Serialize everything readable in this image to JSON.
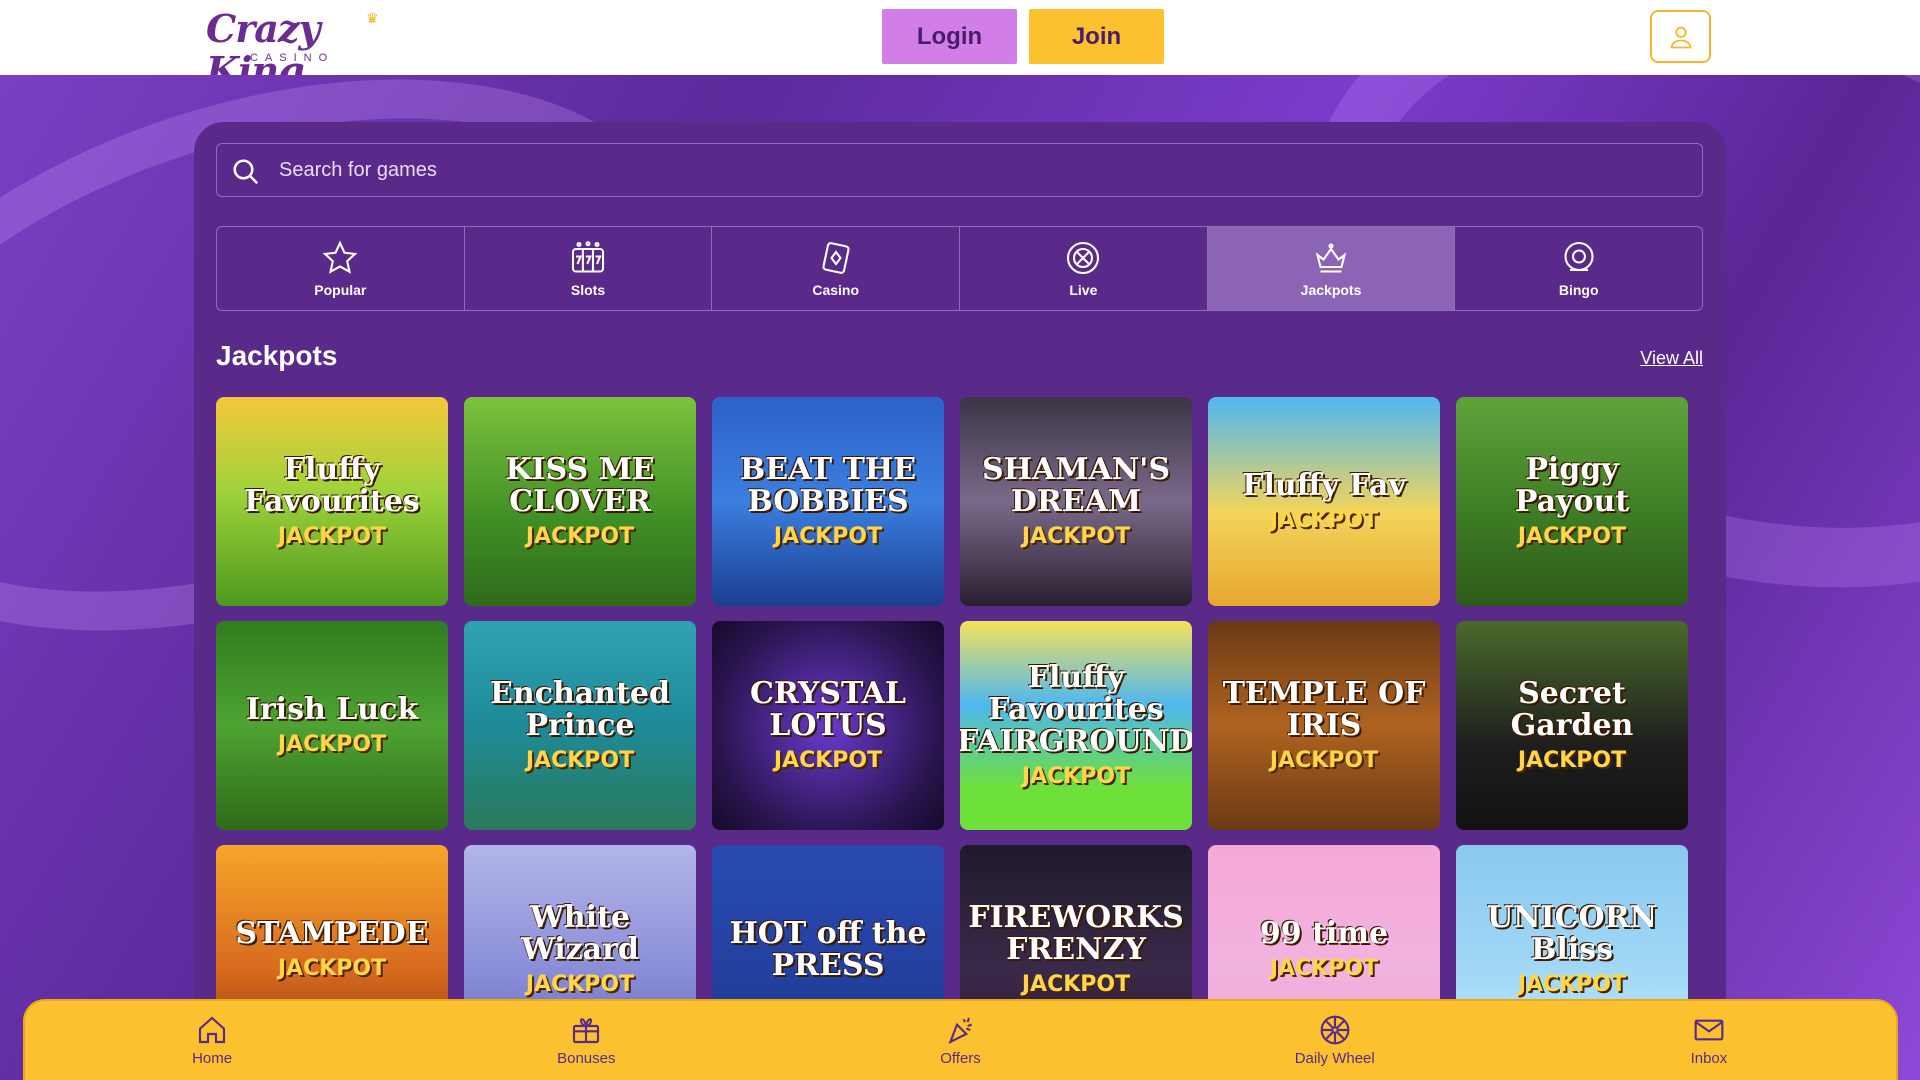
{
  "header": {
    "logo_text": "Crazy King",
    "logo_sub": "CASINO",
    "login_label": "Login",
    "join_label": "Join",
    "account_icon": "user-icon"
  },
  "search": {
    "placeholder": "Search for games",
    "icon": "search-icon"
  },
  "categories": [
    {
      "label": "Popular",
      "icon": "star-icon",
      "active": false
    },
    {
      "label": "Slots",
      "icon": "slot-machine-icon",
      "active": false
    },
    {
      "label": "Casino",
      "icon": "cards-icon",
      "active": false
    },
    {
      "label": "Live",
      "icon": "roulette-icon",
      "active": false
    },
    {
      "label": "Jackpots",
      "icon": "crown-icon",
      "active": true
    },
    {
      "label": "Bingo",
      "icon": "bingo-ball-icon",
      "active": false
    }
  ],
  "section": {
    "title": "Jackpots",
    "view_all": "View All"
  },
  "games": [
    {
      "name": "Fluffy Favourites",
      "sub": "JACKPOT",
      "bg": "linear-gradient(180deg,#f5c83a 0%,#9fd33a 45%,#4e9a1e 100%)"
    },
    {
      "name": "KISS ME CLOVER",
      "sub": "JACKPOT",
      "bg": "linear-gradient(180deg,#7cc23b 0%,#3f8e25 60%,#2e6a1a 100%)"
    },
    {
      "name": "BEAT THE BOBBIES",
      "sub": "JACKPOT",
      "bg": "linear-gradient(180deg,#2d62c9 0%,#3b7fe0 50%,#1c3f92 100%)"
    },
    {
      "name": "SHAMAN'S DREAM",
      "sub": "JACKPOT",
      "bg": "linear-gradient(180deg,#3b3545 0%,#7a6a8a 50%,#2a2030 100%)"
    },
    {
      "name": "Fluffy Fav",
      "sub": "JACKPOT",
      "bg": "linear-gradient(180deg,#4fb7f0 0%,#f2d55a 55%,#e9a630 100%)"
    },
    {
      "name": "Piggy Payout",
      "sub": "JACKPOT",
      "bg": "linear-gradient(180deg,#5fa33a 0%,#3b7a23 60%,#2e5a1a 100%)"
    },
    {
      "name": "Irish Luck",
      "sub": "JACKPOT",
      "bg": "linear-gradient(180deg,#2f7d1e 0%,#4ea332 50%,#2e6a18 100%)"
    },
    {
      "name": "Enchanted Prince",
      "sub": "JACKPOT",
      "bg": "linear-gradient(180deg,#2fa3b3 0%,#1e8a99 50%,#2a7a5a 100%)"
    },
    {
      "name": "CRYSTAL LOTUS",
      "sub": "JACKPOT",
      "bg": "radial-gradient(circle,#6a3ad0 0%,#2a1550 70%,#140a28 100%)"
    },
    {
      "name": "Fluffy Favourites FAIRGROUND",
      "sub": "JACKPOT",
      "bg": "linear-gradient(180deg,#f5e35a 0%,#4fb7f0 40%,#6ee03a 80%)"
    },
    {
      "name": "TEMPLE OF IRIS",
      "sub": "JACKPOT",
      "bg": "linear-gradient(180deg,#6a3a15 0%,#b0631f 50%,#6a3a15 100%)"
    },
    {
      "name": "Secret Garden",
      "sub": "JACKPOT",
      "bg": "linear-gradient(180deg,#4a6a2a 0%,#1e1e1e 60%,#121212 100%)"
    },
    {
      "name": "STAMPEDE",
      "sub": "JACKPOT",
      "bg": "linear-gradient(180deg,#f5a52a 0%,#d86a1e 60%,#8a3a10 100%)"
    },
    {
      "name": "White Wizard",
      "sub": "JACKPOT",
      "bg": "linear-gradient(180deg,#b3b6e8 0%,#8a8ed8 60%,#6a6ec0 100%)"
    },
    {
      "name": "HOT off the PRESS",
      "sub": "",
      "bg": "linear-gradient(180deg,#2a4ab3 0%,#1e3a92 100%)"
    },
    {
      "name": "FIREWORKS FRENZY",
      "sub": "JACKPOT",
      "bg": "linear-gradient(180deg,#1e1a2a 0%,#3a2a4a 60%,#2a1a30 100%)"
    },
    {
      "name": "99 time",
      "sub": "JACKPOT",
      "bg": "linear-gradient(180deg,#f5a8d8 0%,#f2b3e0 60%,#e8a0d0 100%)"
    },
    {
      "name": "UNICORN Bliss",
      "sub": "JACKPOT",
      "bg": "linear-gradient(180deg,#8ac8f0 0%,#a0d8f5 60%,#c0e8ff 100%)"
    }
  ],
  "bottom_nav": [
    {
      "label": "Home",
      "icon": "home-icon"
    },
    {
      "label": "Bonuses",
      "icon": "gift-icon"
    },
    {
      "label": "Offers",
      "icon": "confetti-icon"
    },
    {
      "label": "Daily Wheel",
      "icon": "wheel-icon"
    },
    {
      "label": "Inbox",
      "icon": "mail-icon"
    }
  ],
  "colors": {
    "accent_yellow": "#fbc12f",
    "login_pink": "#d17ee8",
    "panel_purple": "#5a2a8a",
    "active_tab": "#8b64b5"
  }
}
